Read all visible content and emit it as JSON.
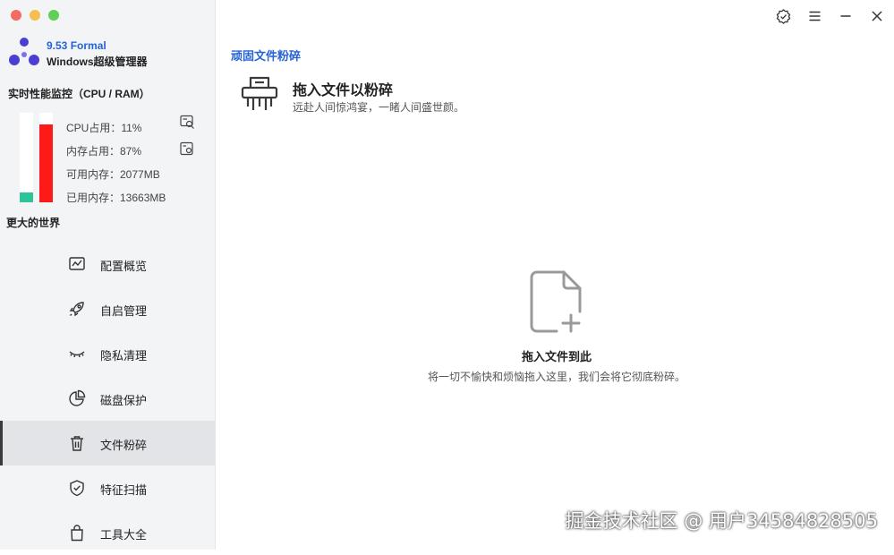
{
  "window": {
    "traffic_lights": [
      "close",
      "minimize",
      "maximize"
    ],
    "top_icons": [
      "verified-badge-icon",
      "menu-icon",
      "minimize-icon",
      "close-icon"
    ]
  },
  "app": {
    "version": "9.53 Formal",
    "name": "Windows超级管理器",
    "brand_color": "#2563d6"
  },
  "monitor": {
    "title": "实时性能监控（CPU / RAM）",
    "cpu_label": "CPU占用：11%",
    "mem_label": "内存占用：87%",
    "available_label": "可用内存：2077MB",
    "used_label": "已用内存：13663MB",
    "cpu_percent": 11,
    "mem_percent": 87,
    "cpu_color": "#2ec49a",
    "mem_color": "#ff1a1a"
  },
  "slogan": "更大的世界",
  "nav": [
    {
      "label": "配置概览",
      "icon": "chart-icon"
    },
    {
      "label": "自启管理",
      "icon": "rocket-icon"
    },
    {
      "label": "隐私清理",
      "icon": "closed-eye-icon"
    },
    {
      "label": "磁盘保护",
      "icon": "pie-chart-icon"
    },
    {
      "label": "文件粉碎",
      "icon": "trash-icon",
      "active": true
    },
    {
      "label": "特征扫描",
      "icon": "shield-icon"
    },
    {
      "label": "工具大全",
      "icon": "bag-icon"
    }
  ],
  "main": {
    "section_title": "顽固文件粉碎",
    "feature_title": "拖入文件以粉碎",
    "feature_subtitle": "远赴人间惊鸿宴，一睹人间盛世颜。",
    "drop_title": "拖入文件到此",
    "drop_subtitle": "将一切不愉快和烦恼拖入这里，我们会将它彻底粉碎。"
  },
  "watermark": "掘金技术社区 @ 用户34584828505"
}
